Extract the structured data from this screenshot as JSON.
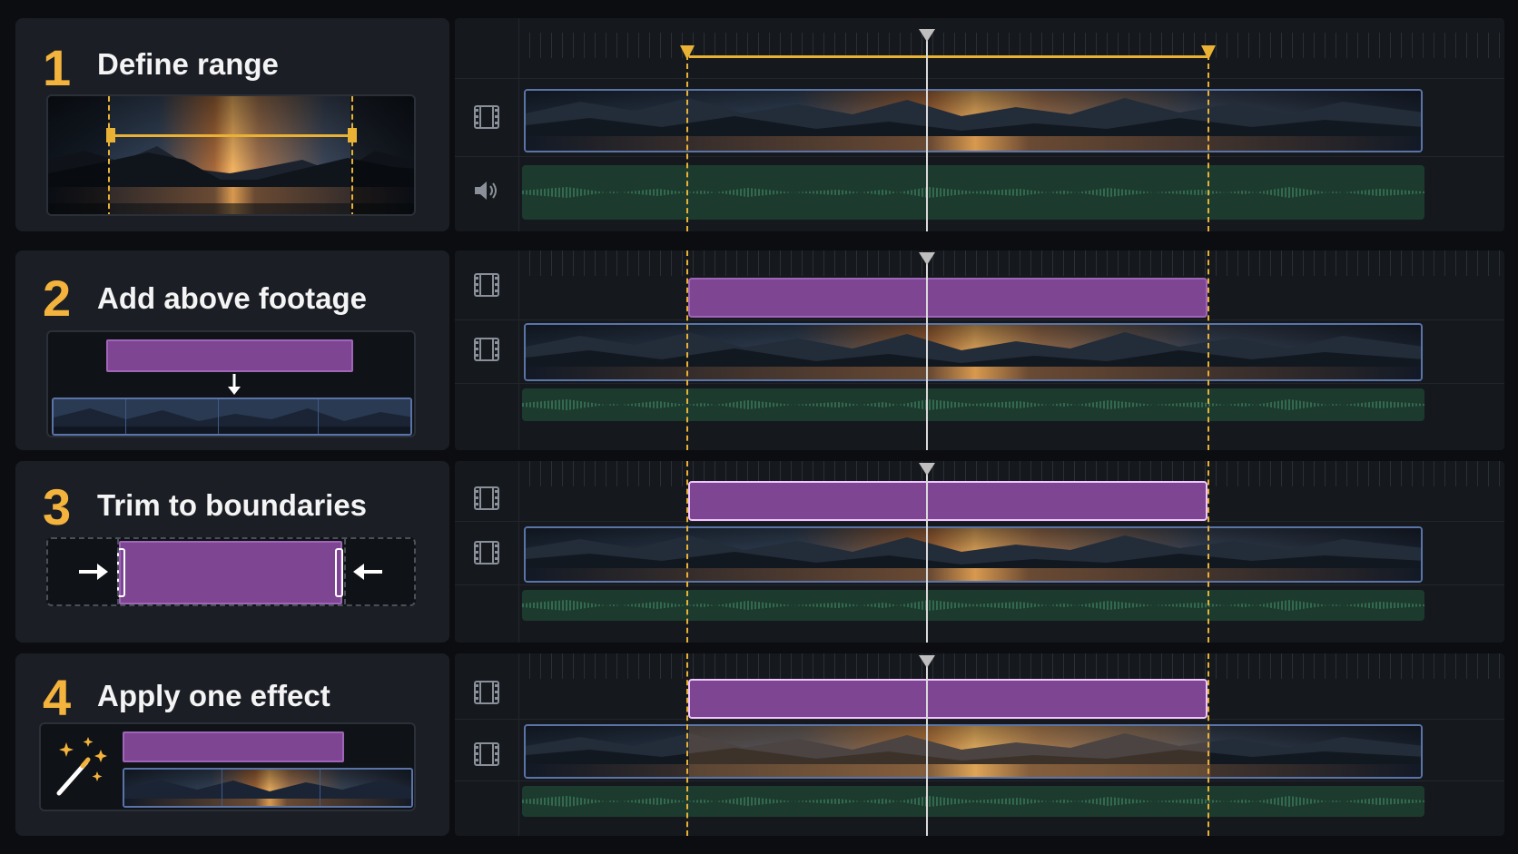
{
  "steps": [
    {
      "number": "1",
      "title": "Define range"
    },
    {
      "number": "2",
      "title": "Add above footage"
    },
    {
      "number": "3",
      "title": "Trim to boundaries"
    },
    {
      "number": "4",
      "title": "Apply one effect"
    }
  ],
  "icons": {
    "video_track": "film-icon",
    "audio_track": "speaker-icon",
    "effect": "magic-wand-icon",
    "arrow_right": "arrow-right-icon",
    "arrow_left": "arrow-left-icon",
    "arrow_down": "arrow-down-icon"
  },
  "colors": {
    "accent": "#f3b33d",
    "range_marker": "#e9b235",
    "adjustment_clip": "#7d4592",
    "video_clip_border": "#5a74a8",
    "audio_clip": "#1c3b2e",
    "playhead": "#d9d9d9"
  }
}
